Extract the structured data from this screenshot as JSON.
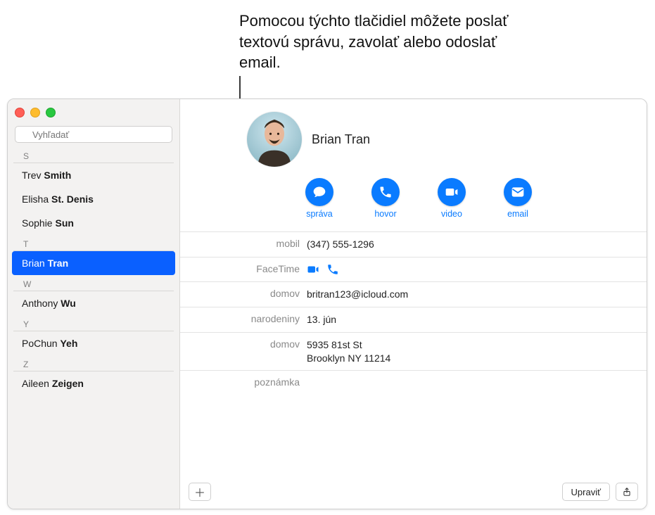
{
  "callout": {
    "text": "Pomocou týchto tlačidiel môžete poslať textovú správu, zavolať alebo odoslať email."
  },
  "search": {
    "placeholder": "Vyhľadať"
  },
  "sections": {
    "s": "S",
    "t": "T",
    "w": "W",
    "y": "Y",
    "z": "Z"
  },
  "contacts": {
    "s": [
      {
        "first": "Trev",
        "last": "Smith"
      },
      {
        "first": "Elisha",
        "last": "St. Denis"
      },
      {
        "first": "Sophie",
        "last": "Sun"
      }
    ],
    "t": [
      {
        "first": "Brian",
        "last": "Tran",
        "selected": true
      }
    ],
    "w": [
      {
        "first": "Anthony",
        "last": "Wu"
      }
    ],
    "y": [
      {
        "first": "PoChun",
        "last": "Yeh"
      }
    ],
    "z": [
      {
        "first": "Aileen",
        "last": "Zeigen"
      }
    ]
  },
  "detail": {
    "name": "Brian Tran",
    "actions": {
      "message": "správa",
      "call": "hovor",
      "video": "video",
      "email": "email"
    },
    "fields": {
      "mobile_label": "mobil",
      "mobile_value": "(347) 555-1296",
      "facetime_label": "FaceTime",
      "home_email_label": "domov",
      "home_email_value": "britran123@icloud.com",
      "birthday_label": "narodeniny",
      "birthday_value": "13. jún",
      "home_addr_label": "domov",
      "home_addr_line1": "5935 81st St",
      "home_addr_line2": "Brooklyn NY 11214",
      "note_label": "poznámka"
    }
  },
  "footer": {
    "edit": "Upraviť"
  }
}
